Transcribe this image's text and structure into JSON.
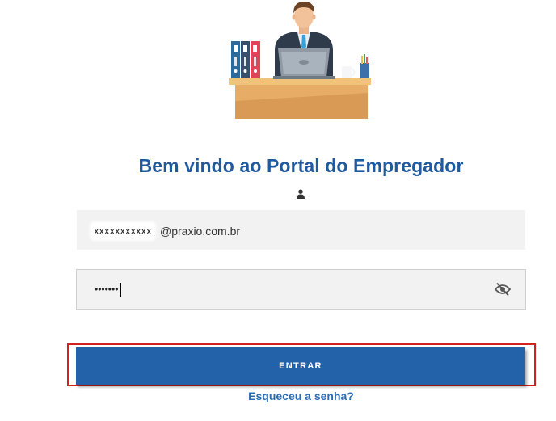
{
  "header": {
    "illustration": "employer-at-desk-illustration",
    "title": "Bem vindo ao Portal do Empregador",
    "user_icon": "user-icon"
  },
  "login_form": {
    "email_value_redacted": "xxxxxxxxxxx",
    "email_value_domain": "@praxio.com.br",
    "password_value_masked": "•••••••",
    "show_password_icon": "eye-slash-icon",
    "submit_label": "ENTRAR",
    "forgot_password_label": "Esqueceu a senha?"
  },
  "colors": {
    "title": "#1f5a9e",
    "button": "#2362a8",
    "link": "#2c6cb3",
    "highlight": "#d32020"
  }
}
